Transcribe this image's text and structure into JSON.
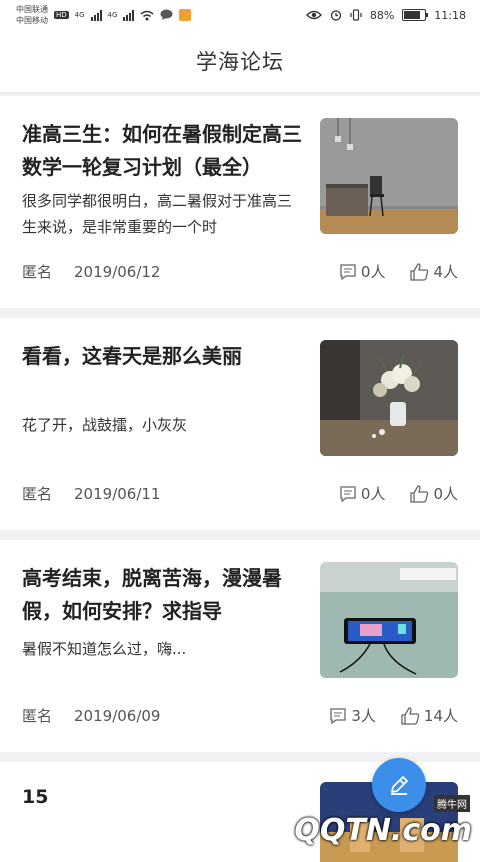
{
  "status": {
    "carrier1": "中国联通",
    "carrier2": "中国移动",
    "net1": "4G",
    "net2": "4G",
    "hd": "HD",
    "battery": "88%",
    "battery_level": 0.88,
    "time": "11:18"
  },
  "header": {
    "title": "学海论坛"
  },
  "posts": [
    {
      "title": "准高三生：如何在暑假制定高三数学一轮复习计划（最全）",
      "excerpt": "很多同学都很明白，高二暑假对于准高三生来说，是非常重要的一个时",
      "author": "匿名",
      "date": "2019/06/12",
      "comments": "0人",
      "likes": "4人"
    },
    {
      "title": "看看，这春天是那么美丽",
      "excerpt": "花了开，战鼓擂，小灰灰",
      "author": "匿名",
      "date": "2019/06/11",
      "comments": "0人",
      "likes": "0人"
    },
    {
      "title": "高考结束，脱离苦海，漫漫暑假，如何安排？求指导",
      "excerpt": "暑假不知道怎么过，嗨...",
      "author": "匿名",
      "date": "2019/06/09",
      "comments": "3人",
      "likes": "14人"
    },
    {
      "title": "15"
    }
  ],
  "watermark": {
    "text": "QQTN.com",
    "tag": "腾牛网"
  },
  "icons": {
    "comment": "comment-icon",
    "like": "thumbs-up-icon",
    "fab": "edit-pen-icon"
  },
  "colors": {
    "accent": "#3b8ee9"
  }
}
